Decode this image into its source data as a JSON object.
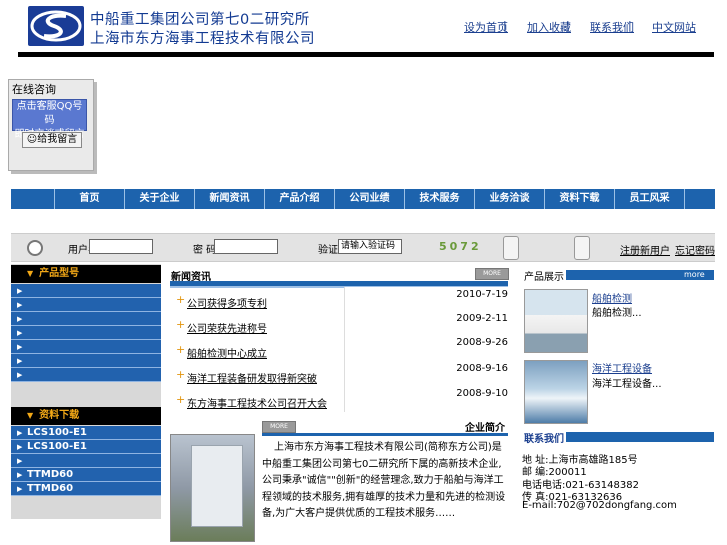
{
  "header": {
    "org_line1": "中船重工集团公司第七0二研究所",
    "org_line2": "上海市东方海事工程技术有限公司",
    "top_links": [
      "设为首页",
      "加入收藏",
      "联系我们",
      "中文网站"
    ]
  },
  "consult": {
    "title": "在线咨询",
    "panel_line1": "点击客服QQ号码",
    "panel_line2": "即时交谈或留言",
    "button": "给我留言"
  },
  "mainnav": [
    "首页",
    "关于企业",
    "新闻资讯",
    "产品介绍",
    "公司业绩",
    "技术服务",
    "业务洽谈",
    "资料下载",
    "员工风采"
  ],
  "search": {
    "label1": "用户名:",
    "label2": "密  码:",
    "label3": "验证码:",
    "code_value": "请输入验证码",
    "counter": "5072",
    "link1": "注册新用户",
    "link2": "忘记密码"
  },
  "left": {
    "product_head": "产品型号",
    "product_items": [
      "",
      "",
      "",
      "",
      "",
      "",
      "",
      ""
    ],
    "download_head": "资料下载",
    "download_items": [
      "LCS100-E1",
      "LCS100-E1",
      "",
      "TTMD60",
      "TTMD60"
    ]
  },
  "news": {
    "title": "新闻资讯",
    "more": "MORE",
    "items": [
      {
        "title": "公司获得多项专利",
        "date": "2010-7-19"
      },
      {
        "title": "公司荣获先进称号",
        "date": "2009-2-11"
      },
      {
        "title": "船舶检测中心成立",
        "date": "2008-9-26"
      },
      {
        "title": "海洋工程装备研发取得新突破",
        "date": "2008-9-16"
      },
      {
        "title": "东方海事工程技术公司召开大会",
        "date": "2008-9-10"
      }
    ]
  },
  "intro": {
    "title": "企业简介",
    "more": "MORE",
    "text": "上海市东方海事工程技术有限公司(简称东方公司)是中船重工集团公司第七0二研究所下属的高新技术企业,公司秉承\"诚信\"\"创新\"的经营理念,致力于船舶与海洋工程领域的技术服务,拥有雄厚的技术力量和先进的检测设备,为广大客户提供优质的工程技术服务……"
  },
  "products": {
    "title": "产品展示",
    "more": "more",
    "items": [
      {
        "name": "船舶检测",
        "desc": "船舶检测..."
      },
      {
        "name": "海洋工程设备",
        "desc": "海洋工程设备..."
      }
    ]
  },
  "contact": {
    "title": "联系我们",
    "lines": [
      "地 址:上海市高雄路185号",
      "邮 编:200011",
      "电话电话:021-63148382",
      "传 真:021-63132636",
      "E-mail:702@702dongfang.com"
    ]
  },
  "colors": {
    "brand_blue": "#1d63ad",
    "accent_orange": "#f2a817"
  }
}
